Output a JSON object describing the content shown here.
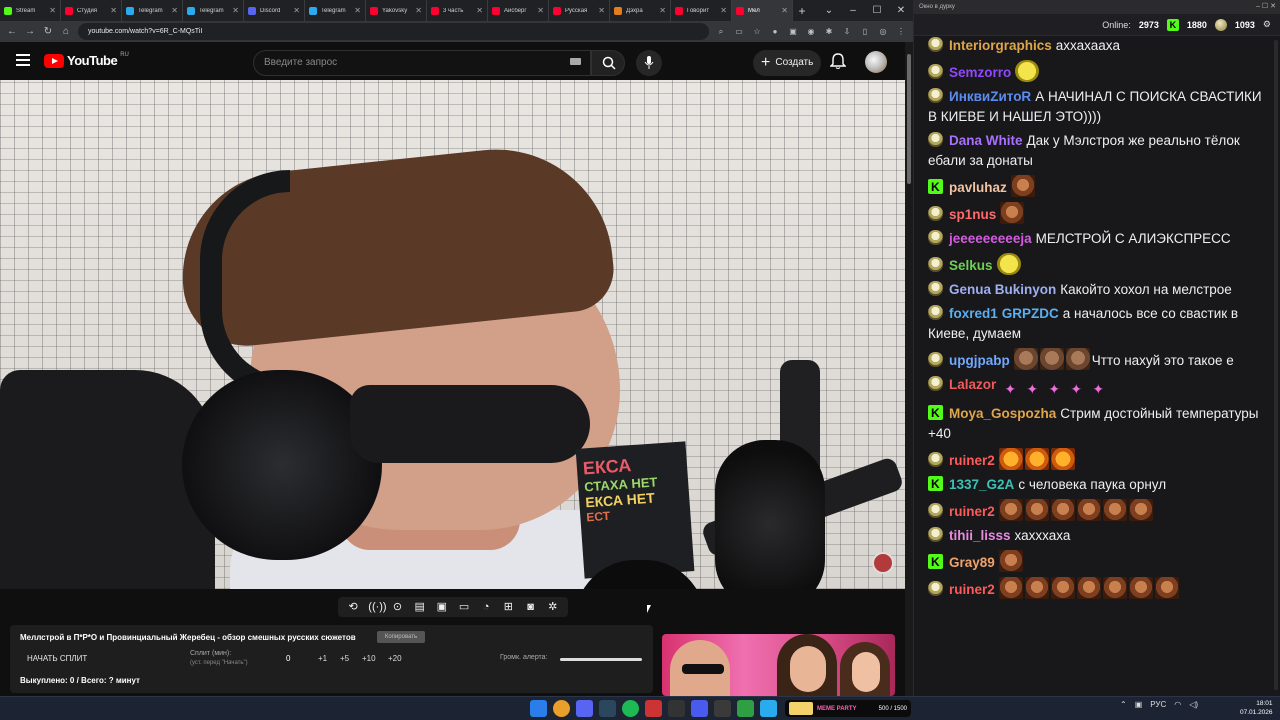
{
  "browser": {
    "tabs": [
      {
        "label": "Stream",
        "color": "#53fc18",
        "active": false
      },
      {
        "label": "Студия",
        "color": "#ff0033",
        "active": false
      },
      {
        "label": "Telegram",
        "color": "#2aabee",
        "active": false
      },
      {
        "label": "Telegram",
        "color": "#2aabee",
        "active": false
      },
      {
        "label": "Discord",
        "color": "#5865f2",
        "active": false
      },
      {
        "label": "Telegram",
        "color": "#2aabee",
        "active": false
      },
      {
        "label": "Yakovsky",
        "color": "#ff0033",
        "active": false
      },
      {
        "label": "3 часть",
        "color": "#ff0033",
        "active": false
      },
      {
        "label": "Айсберг",
        "color": "#ff0033",
        "active": false
      },
      {
        "label": "Русская",
        "color": "#ff0033",
        "active": false
      },
      {
        "label": "Дэхра",
        "color": "#e37f1b",
        "active": false
      },
      {
        "label": "Говорит",
        "color": "#ff0033",
        "active": false
      },
      {
        "label": "Мел",
        "color": "#ff0033",
        "active": true
      }
    ],
    "url": "youtube.com/watch?v=6R_C-MQsTiI"
  },
  "youtube": {
    "logo_text": "YouTube",
    "region": "RU",
    "search_placeholder": "Введите запрос",
    "create_label": "Создать"
  },
  "video": {
    "sign_line1": "ЕКСА",
    "sign_line2": "СТАХА НЕТ",
    "sign_line3": "ЕКСА НЕТ",
    "sign_line4": "ЕСТ"
  },
  "infopanel": {
    "title": "Меллстрой в П*Р*О и Провинциальный Жеребец - обзор смешных русских сюжетов",
    "copy_label": "Копировать",
    "start_split": "НАЧАТЬ СПЛИТ",
    "split_label": "Сплит (мин):",
    "split_hint": "(уст. перед \"Начать\")",
    "split_value": "0",
    "steps": [
      "+1",
      "+5",
      "+10",
      "+20"
    ],
    "alert_label": "Громк. алерта:",
    "bought": "Выкуплено: 0 / Всего: ? минут"
  },
  "chat": {
    "window_title": "Окно в дурку",
    "online_label": "Online:",
    "online_value": "2973",
    "kick_value": "1880",
    "points_value": "1093",
    "messages": [
      {
        "user": "Interiorgraphics",
        "color": "#e0a44a",
        "badge": "pepe",
        "text": "аххахаахa"
      },
      {
        "user": "Semzorro",
        "color": "#9147ff",
        "badge": "pepe",
        "text": ""
      },
      {
        "user": "ИнквиZитоR",
        "color": "#5b8cf0",
        "badge": "pepe",
        "text": "А НАЧИНАЛ С ПОИСКА СВАСТИКИ В КИЕВЕ И НАШЕЛ ЭТО))))"
      },
      {
        "user": "Dana White",
        "color": "#a970ff",
        "badge": "pepe",
        "text": "Дак у Мэлстроя же реально тёлок ебали за донаты"
      },
      {
        "user": "pavluhaz",
        "color": "#f2c3a3",
        "badge": "kick",
        "text": ""
      },
      {
        "user": "sp1nus",
        "color": "#ff6b6b",
        "badge": "pepe",
        "text": ""
      },
      {
        "user": "jeeeeeeeeeja",
        "color": "#d45be0",
        "badge": "pepe",
        "text": "МЕЛСТРОЙ С АЛИЭКСПРЕСС"
      },
      {
        "user": "Selkus",
        "color": "#6fcf57",
        "badge": "pepe",
        "text": ""
      },
      {
        "user": "Genua Bukinyon",
        "color": "#9eaff0",
        "badge": "pepe",
        "text": "Какойто хохол на мелстрое"
      },
      {
        "user": "foxred1",
        "color": "#5ab0f0",
        "badge": "pepe",
        "user2": "GRPZDC",
        "text": "а началось все со свастик в Киеве, думаем"
      },
      {
        "user": "upgjpabp",
        "color": "#6fa8ff",
        "badge": "pepe",
        "text": "Чтто нахуй это такое е"
      },
      {
        "user": "Lalazor",
        "color": "#f05a5a",
        "badge": "pepe",
        "text": ""
      },
      {
        "user": "Moya_Gospozha",
        "color": "#e0a44a",
        "badge": "kick",
        "text": "Стрим достойный температуры +40"
      },
      {
        "user": "ruiner2",
        "color": "#ff5a5a",
        "badge": "pepe",
        "text": ""
      },
      {
        "user": "1337_G2A",
        "color": "#3ac2b6",
        "badge": "kick",
        "text": "с человека паука орнул"
      },
      {
        "user": "ruiner2",
        "color": "#ff5a5a",
        "badge": "pepe",
        "text": ""
      },
      {
        "user": "tihii_lisss",
        "color": "#e78bde",
        "badge": "pepe",
        "text": "хахххаха"
      },
      {
        "user": "Gray89",
        "color": "#f0a26b",
        "badge": "kick",
        "text": ""
      },
      {
        "user": "ruiner2",
        "color": "#ff5a5a",
        "badge": "pepe",
        "text": ""
      }
    ]
  },
  "taskbar": {
    "media_title": "MEME PARTY",
    "media_count": "500 / 1500",
    "lang": "РУС",
    "time": "18:01",
    "date": "07.01.2026"
  }
}
